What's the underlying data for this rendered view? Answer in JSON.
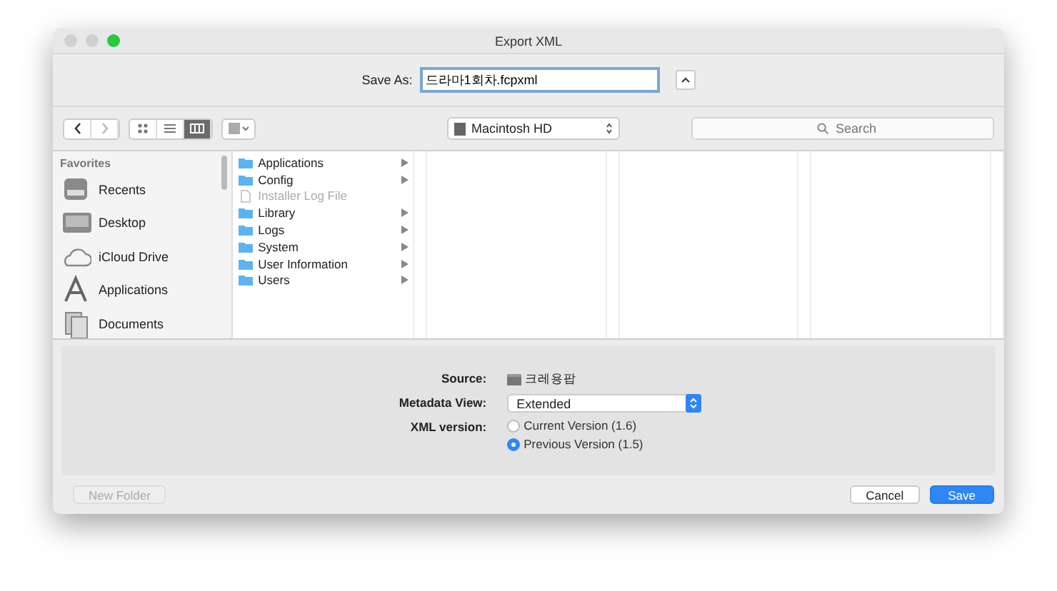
{
  "window": {
    "title": "Export XML"
  },
  "save_as": {
    "label": "Save As:",
    "value": "드라마1회차.fcpxml"
  },
  "toolbar": {
    "views": [
      {
        "selected": false
      },
      {
        "selected": false
      },
      {
        "selected": true
      }
    ],
    "location": "Macintosh HD",
    "search": {
      "placeholder": "Search"
    }
  },
  "sidebar": {
    "section": "Favorites",
    "items": [
      {
        "label": "Recents"
      },
      {
        "label": "Desktop"
      },
      {
        "label": "iCloud Drive"
      },
      {
        "label": "Applications"
      },
      {
        "label": "Documents"
      }
    ]
  },
  "files": [
    {
      "name": "Applications",
      "kind": "folder",
      "disabled": false
    },
    {
      "name": "Config",
      "kind": "folder",
      "disabled": false
    },
    {
      "name": "Installer Log File",
      "kind": "file",
      "disabled": true
    },
    {
      "name": "Library",
      "kind": "folder",
      "disabled": false
    },
    {
      "name": "Logs",
      "kind": "folder",
      "disabled": false
    },
    {
      "name": "System",
      "kind": "folder",
      "disabled": false
    },
    {
      "name": "User Information",
      "kind": "folder",
      "disabled": false
    },
    {
      "name": "Users",
      "kind": "folder",
      "disabled": false
    }
  ],
  "options": {
    "source": {
      "label": "Source:",
      "value": "크레용팝"
    },
    "metadata_view": {
      "label": "Metadata View:",
      "value": "Extended"
    },
    "xml_version": {
      "label": "XML version:",
      "choices": [
        {
          "label": "Current Version (1.6)",
          "selected": false
        },
        {
          "label": "Previous Version (1.5)",
          "selected": true
        }
      ]
    }
  },
  "buttons": [
    {
      "label": "New Folder",
      "kind": "normal",
      "disabled": true
    },
    {
      "label": "Cancel",
      "kind": "normal",
      "disabled": false
    },
    {
      "label": "Save",
      "kind": "default",
      "disabled": false
    }
  ]
}
